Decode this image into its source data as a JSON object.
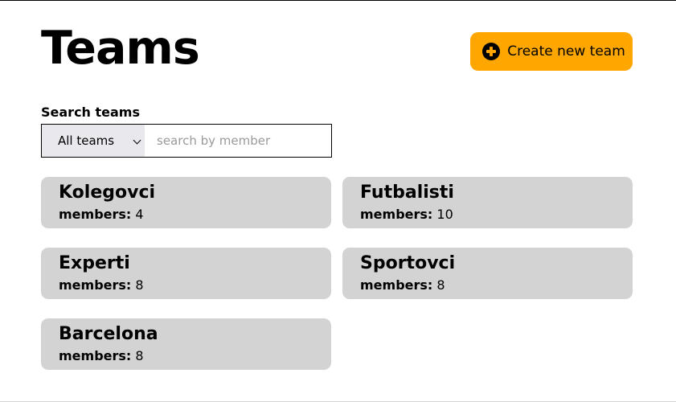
{
  "header": {
    "title": "Teams",
    "create_button_label": "Create new team",
    "accent_color": "#ffa600"
  },
  "search": {
    "label": "Search teams",
    "filter_selected": "All teams",
    "placeholder": "search by member"
  },
  "teams": [
    {
      "name": "Kolegovci",
      "members_label": "members:",
      "members": "4"
    },
    {
      "name": "Futbalisti",
      "members_label": "members:",
      "members": "10"
    },
    {
      "name": "Experti",
      "members_label": "members:",
      "members": "8"
    },
    {
      "name": "Sportovci",
      "members_label": "members:",
      "members": "8"
    },
    {
      "name": "Barcelona",
      "members_label": "members:",
      "members": "8"
    }
  ]
}
